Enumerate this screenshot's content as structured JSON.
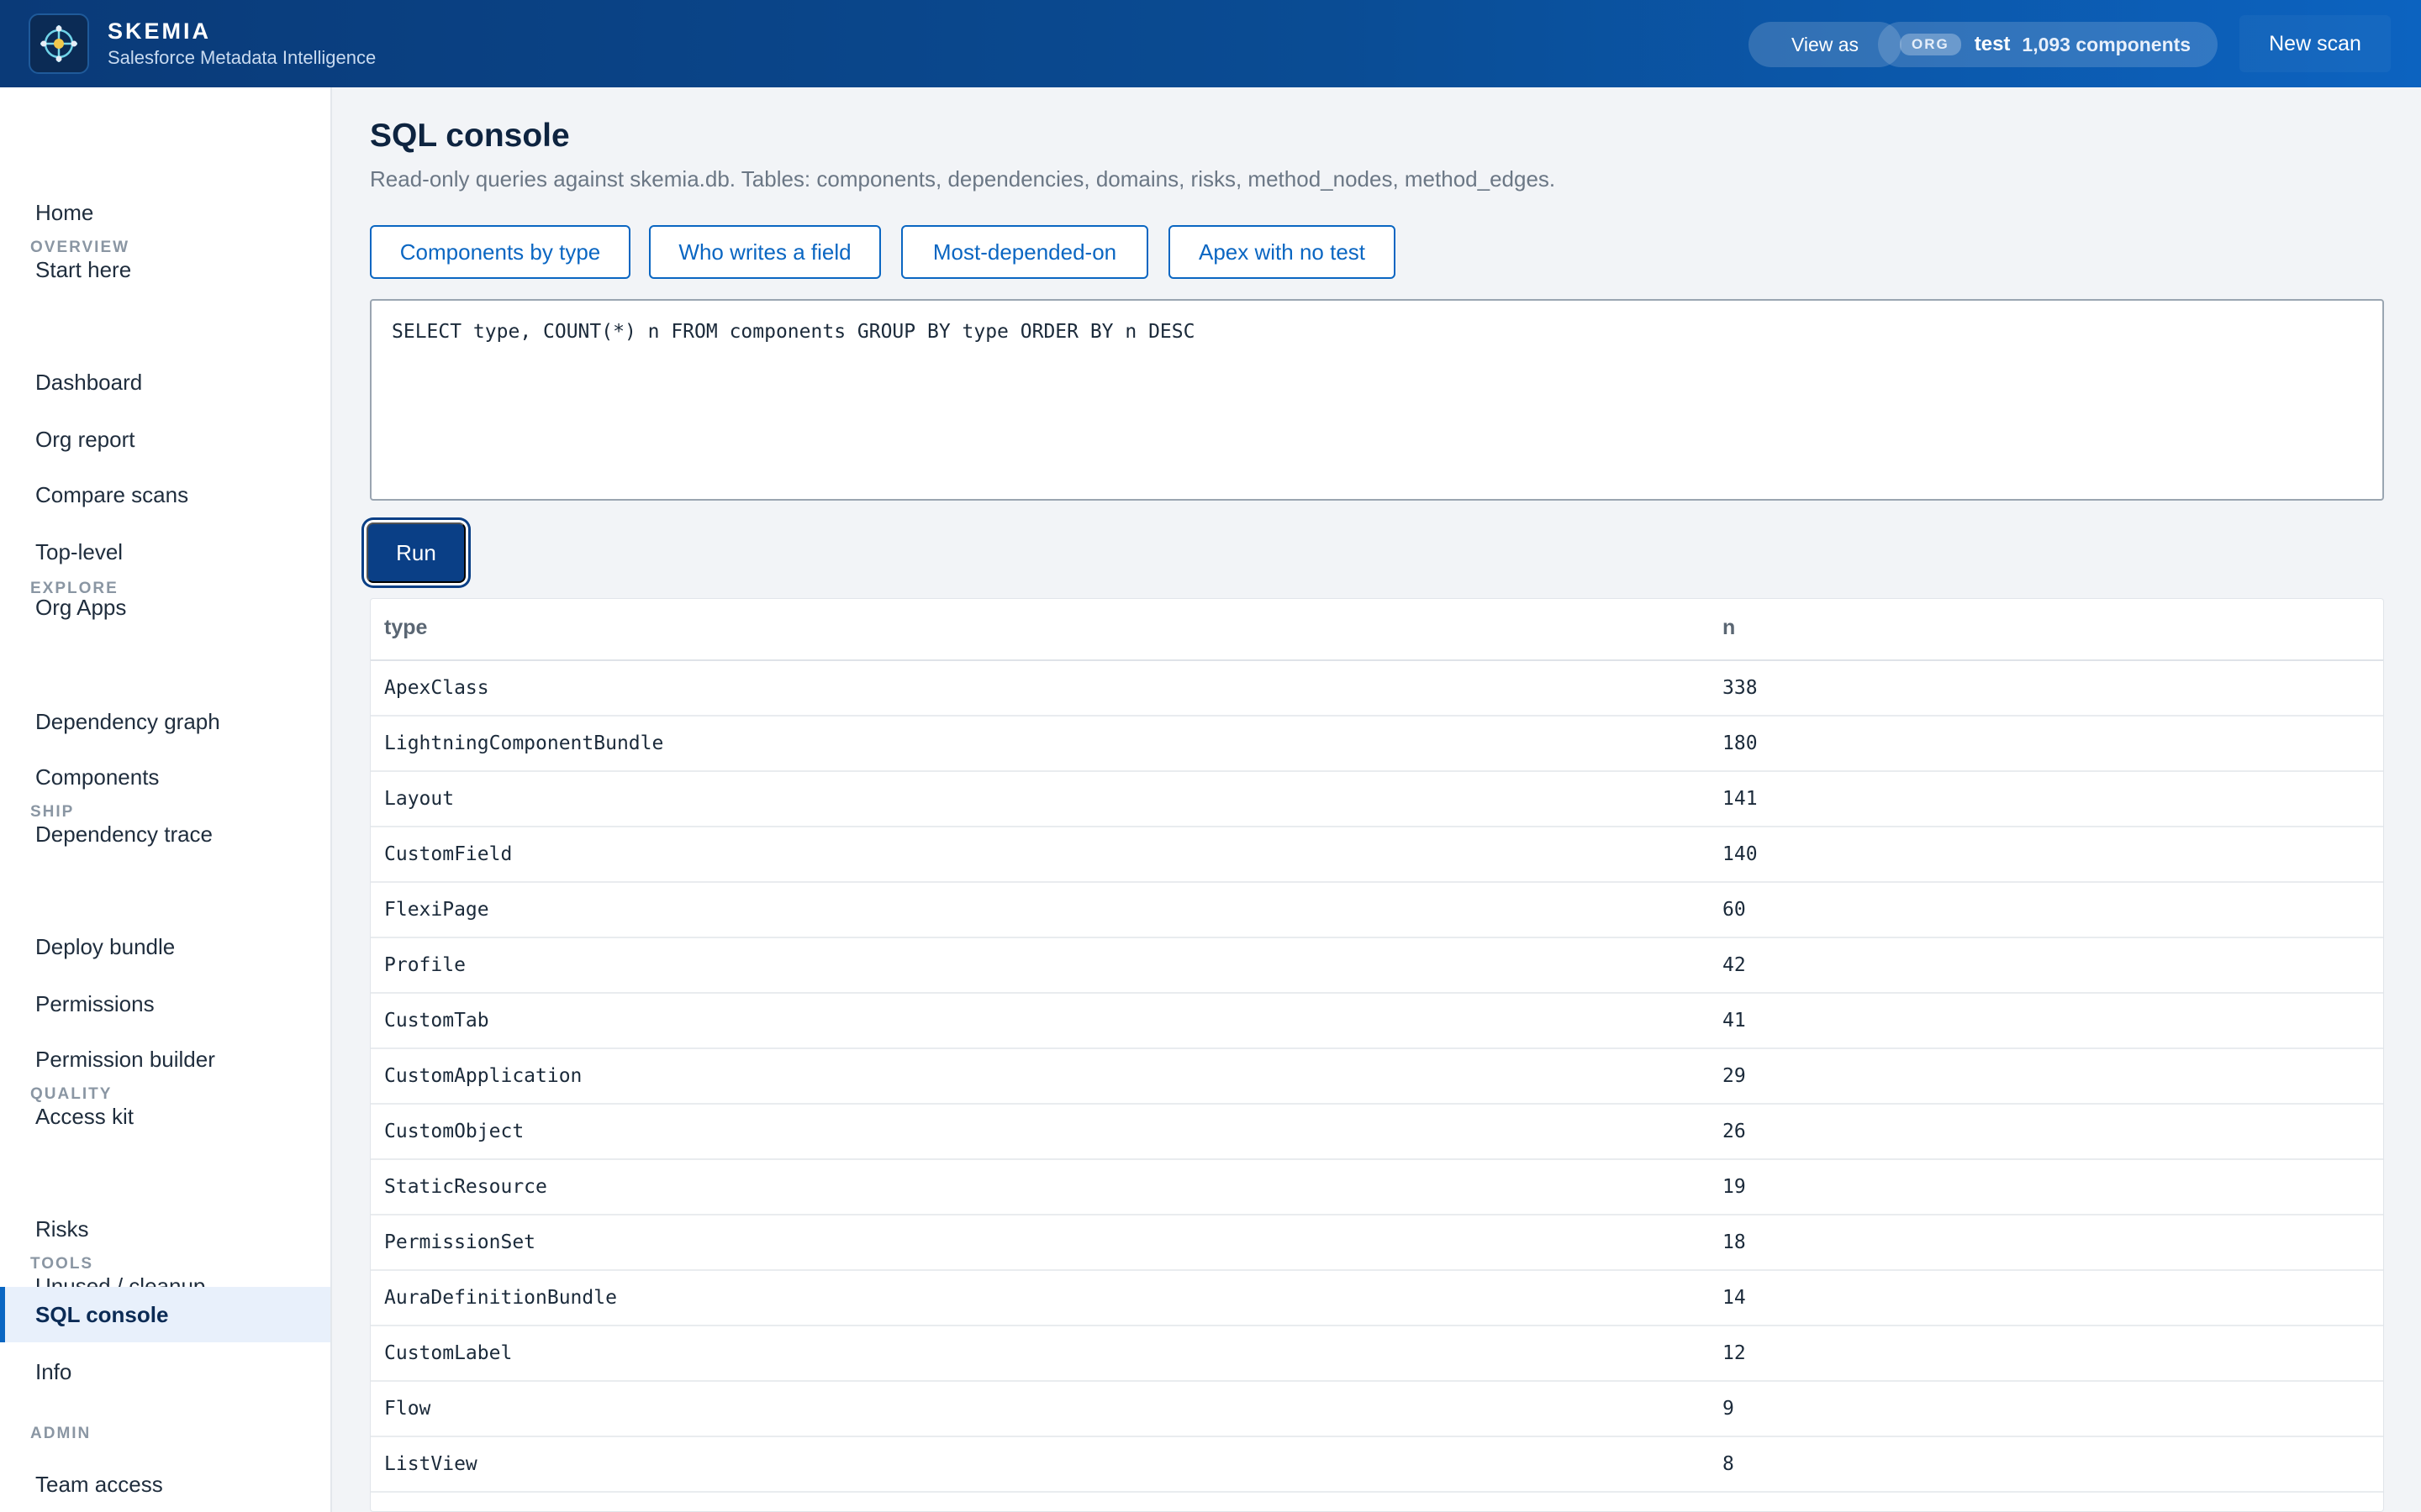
{
  "header": {
    "brand_name": "SKEMIA",
    "brand_sub": "Salesforce Metadata Intelligence",
    "view_as_label": "View as",
    "org_tag": "ORG",
    "org_name": "test",
    "org_count": "1,093 components",
    "new_scan_label": "New scan"
  },
  "sidebar": {
    "items": [
      {
        "label": "Home"
      },
      {
        "label": "Start here"
      },
      {
        "label": "Dashboard"
      },
      {
        "label": "Org report"
      },
      {
        "label": "Compare scans"
      },
      {
        "label": "Top-level"
      },
      {
        "label": "Org Apps"
      },
      {
        "label": "Dependency graph"
      },
      {
        "label": "Components"
      },
      {
        "label": "Dependency trace"
      },
      {
        "label": "Deploy bundle"
      },
      {
        "label": "Permissions"
      },
      {
        "label": "Permission builder"
      },
      {
        "label": "Access kit"
      },
      {
        "label": "Risks"
      },
      {
        "label": "Unused / cleanup"
      },
      {
        "label": "SQL console"
      },
      {
        "label": "Info"
      },
      {
        "label": "Team access"
      }
    ],
    "sections": {
      "overview": "OVERVIEW",
      "explore": "EXPLORE",
      "ship": "SHIP",
      "quality": "QUALITY",
      "tools": "TOOLS",
      "admin": "ADMIN"
    }
  },
  "main": {
    "title": "SQL console",
    "description": "Read-only queries against skemia.db. Tables: components, dependencies, domains, risks, method_nodes, method_edges.",
    "presets": [
      {
        "label": "Components by type"
      },
      {
        "label": "Who writes a field"
      },
      {
        "label": "Most-depended-on"
      },
      {
        "label": "Apex with no test"
      }
    ],
    "query": "SELECT type, COUNT(*) n FROM components GROUP BY type ORDER BY n DESC",
    "run_label": "Run",
    "results": {
      "columns": [
        "type",
        "n"
      ],
      "rows": [
        {
          "type": "ApexClass",
          "n": "338"
        },
        {
          "type": "LightningComponentBundle",
          "n": "180"
        },
        {
          "type": "Layout",
          "n": "141"
        },
        {
          "type": "CustomField",
          "n": "140"
        },
        {
          "type": "FlexiPage",
          "n": "60"
        },
        {
          "type": "Profile",
          "n": "42"
        },
        {
          "type": "CustomTab",
          "n": "41"
        },
        {
          "type": "CustomApplication",
          "n": "29"
        },
        {
          "type": "CustomObject",
          "n": "26"
        },
        {
          "type": "StaticResource",
          "n": "19"
        },
        {
          "type": "PermissionSet",
          "n": "18"
        },
        {
          "type": "AuraDefinitionBundle",
          "n": "14"
        },
        {
          "type": "CustomLabel",
          "n": "12"
        },
        {
          "type": "Flow",
          "n": "9"
        },
        {
          "type": "ListView",
          "n": "8"
        }
      ]
    }
  }
}
